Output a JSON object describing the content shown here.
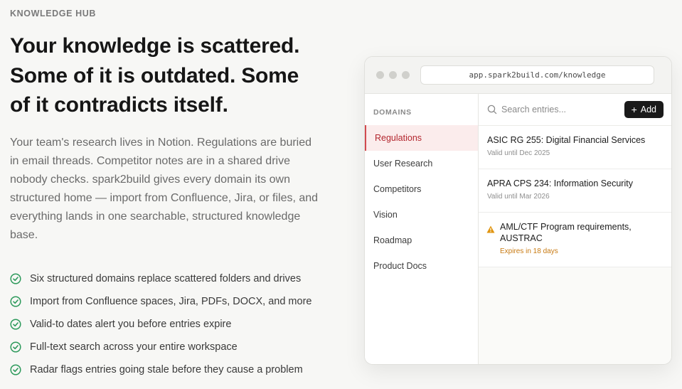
{
  "eyebrow": "KNOWLEDGE HUB",
  "headline": {
    "line1": "Your knowledge is scattered.",
    "line2": "Some of it is outdated. Some",
    "line3": "of it contradicts itself."
  },
  "body": "Your team's research lives in Notion. Regulations are buried in email threads. Competitor notes are in a shared drive nobody checks. spark2build gives every domain its own structured home — import from Confluence, Jira, or files, and everything lands in one searchable, structured knowledge base.",
  "features": [
    "Six structured domains replace scattered folders and drives",
    "Import from Confluence spaces, Jira, PDFs, DOCX, and more",
    "Valid-to dates alert you before entries expire",
    "Full-text search across your entire workspace",
    "Radar flags entries going stale before they cause a problem"
  ],
  "window": {
    "url": "app.spark2build.com/knowledge",
    "sidebar": {
      "heading": "DOMAINS",
      "items": [
        "Regulations",
        "User Research",
        "Competitors",
        "Vision",
        "Roadmap",
        "Product Docs"
      ],
      "active_index": 0
    },
    "search": {
      "placeholder": "Search entries..."
    },
    "add_label": "Add",
    "entries": [
      {
        "title": "ASIC RG 255: Digital Financial Services",
        "meta": "Valid until Dec 2025",
        "warning": false
      },
      {
        "title": "APRA CPS 234: Information Security",
        "meta": "Valid until Mar 2026",
        "warning": false
      },
      {
        "title": "AML/CTF Program requirements, AUSTRAC",
        "meta": "Expires in 18 days",
        "warning": true
      }
    ]
  },
  "colors": {
    "accent_red": "#b3262e",
    "check_green": "#2e9a5c",
    "warning_amber": "#e0940f"
  },
  "icons": {
    "feature_check": "check-circle-icon",
    "search": "search-icon",
    "add": "plus-icon",
    "warning": "warning-triangle-icon"
  }
}
